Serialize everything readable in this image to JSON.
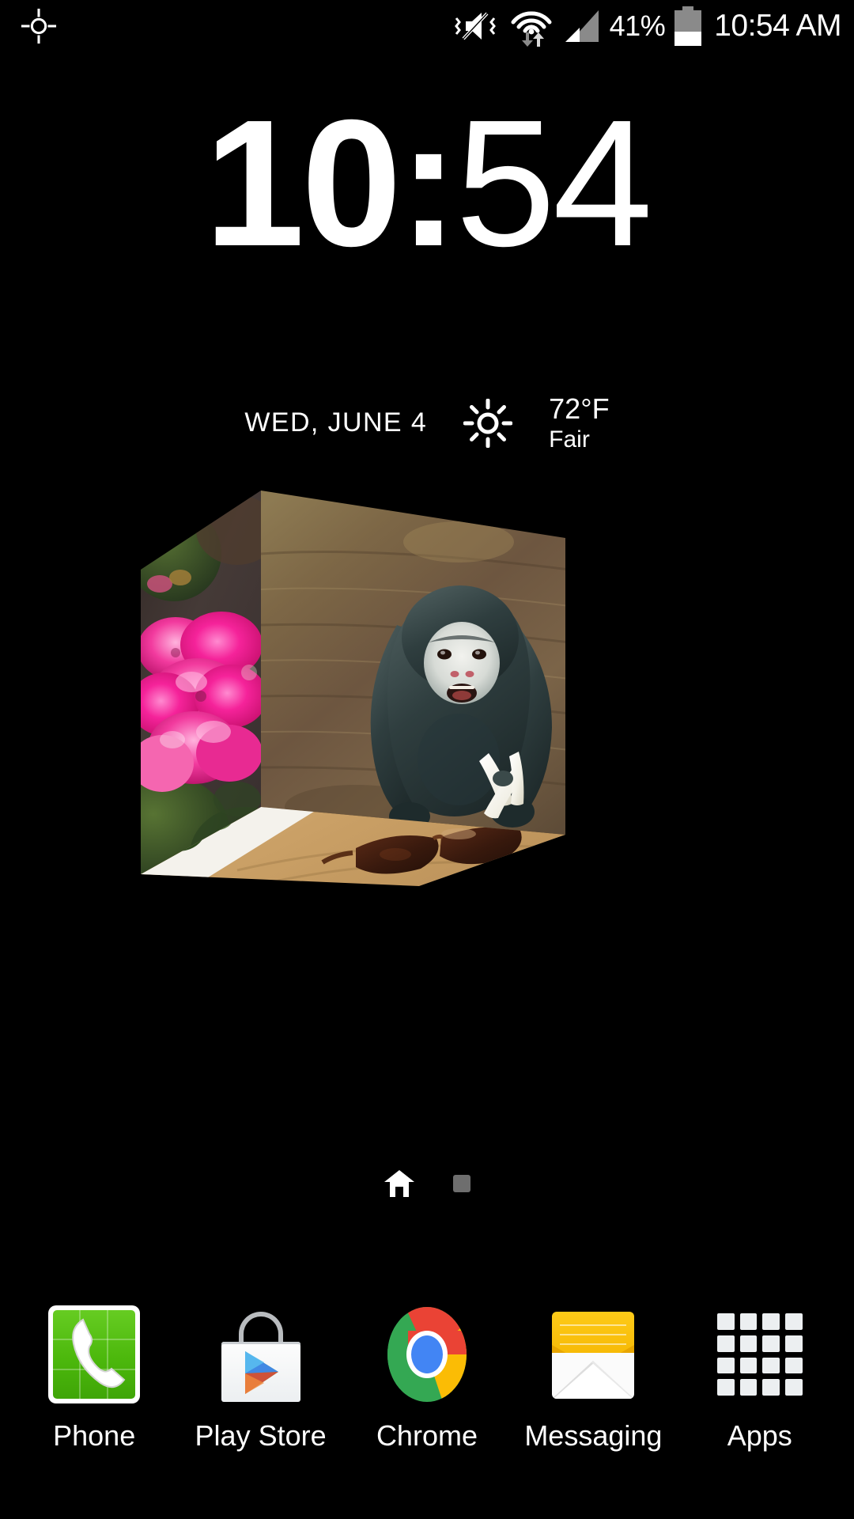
{
  "status_bar": {
    "gps_icon": "gps-crosshair-icon",
    "vibrate_icon": "volume-mute-vibrate-icon",
    "wifi_icon": "wifi-data-transfer-icon",
    "signal_icon": "cellular-signal-icon",
    "battery_percent": "41%",
    "battery_level": 41,
    "battery_icon": "battery-icon",
    "clock": "10:54 AM"
  },
  "clock_widget": {
    "hours": "10",
    "separator": ":",
    "minutes": "54",
    "date": "WED, JUNE 4",
    "weather_icon": "sun-clear-icon",
    "temperature": "72°F",
    "condition": "Fair"
  },
  "cube_widget": {
    "name": "3d-photo-cube-widget",
    "faces": [
      {
        "position": "left",
        "subject": "pink flowers"
      },
      {
        "position": "front",
        "subject": "monkey with banana on wooden floor"
      },
      {
        "position": "bottom",
        "subject": "sunglasses on wooden table"
      }
    ]
  },
  "page_indicator": {
    "home_icon": "home-icon",
    "dots": [
      {
        "type": "home",
        "active": true
      },
      {
        "type": "square",
        "active": false
      }
    ]
  },
  "dock": {
    "items": [
      {
        "label": "Phone",
        "icon": "phone-icon"
      },
      {
        "label": "Play Store",
        "icon": "play-store-icon"
      },
      {
        "label": "Chrome",
        "icon": "chrome-icon"
      },
      {
        "label": "Messaging",
        "icon": "messaging-icon"
      },
      {
        "label": "Apps",
        "icon": "apps-grid-icon"
      }
    ]
  },
  "colors": {
    "background": "#000000",
    "text": "#ffffff",
    "battery_gray": "#8a8a8a",
    "dot_gray": "#6e6e6e",
    "phone_green": "#4cb80c",
    "messaging_yellow": "#f4b400",
    "chrome_red": "#ea4335",
    "chrome_yellow": "#fbbc05",
    "chrome_green": "#34a853",
    "chrome_blue": "#4285f4"
  }
}
